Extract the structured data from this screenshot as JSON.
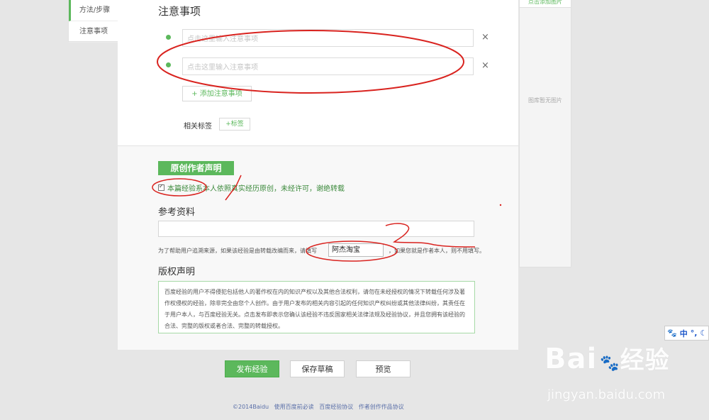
{
  "leftnav": {
    "items": [
      {
        "label": "方法/步骤"
      },
      {
        "label": "注意事项"
      }
    ]
  },
  "rightpanel": {
    "add_image": "点击添加图片",
    "empty_text": "图库暂无图片"
  },
  "notes": {
    "title": "注意事项",
    "items": [
      {
        "placeholder": "点击这里输入注意事项"
      },
      {
        "placeholder": "点击这里输入注意事项"
      }
    ],
    "remove_icon": "×",
    "add_button": "+ 添加注意事项"
  },
  "tags": {
    "label": "相关标签",
    "add_button": "+标签"
  },
  "originality": {
    "badge": "原创作者声明",
    "checkbox_label": "本篇经验系本人依照真实经历原创，未经许可，谢绝转载",
    "checked": true
  },
  "references": {
    "title": "参考资料",
    "note_before": "为了帮助用户追溯来源，如果该经验是由转载改编而来，请填写",
    "source_value": "阿杰淘宝",
    "note_after": "，如果您就是作者本人，则不用填写。"
  },
  "copyright": {
    "title": "版权声明",
    "text": "百度经验的用户不得侵犯包括他人的著作权在内的知识产权以及其他合法权利，请勿在未经授权的情况下转载任何涉及著作权侵权的经验，除非完全由您个人创作。由于用户发布的相关内容引起的任何知识产权纠纷或其他法律纠纷，其责任在于用户本人，与百度经验无关。点击发布即表示您确认该经验不违反国家相关法律法规及经验协议，并且您拥有该经验的合法、完整的版权或者合法、完整的转载授权。"
  },
  "actions": {
    "publish": "发布经验",
    "draft": "保存草稿",
    "preview": "预览"
  },
  "footer": {
    "links": [
      "©2014Baidu",
      "使用百度前必读",
      "百度经验协议",
      "作者创作作品协议"
    ]
  },
  "ime": {
    "paw_icon": "🐾",
    "mode": "中",
    "punct": "°,",
    "extra": "☾"
  },
  "watermark": {
    "brand": "Bai",
    "brand_suffix": "经验",
    "url": "jingyan.baidu.com"
  },
  "colors": {
    "accent": "#5cb85c",
    "annotation": "#d9231f"
  }
}
